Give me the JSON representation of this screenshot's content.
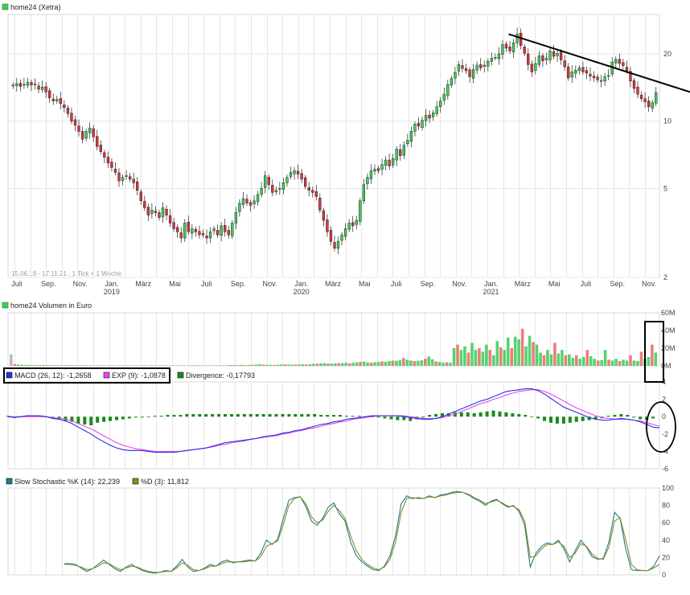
{
  "colors": {
    "up": "#3ecf5a",
    "down": "#d9373b",
    "volume_up": "#55d36e",
    "volume_down": "#ef7c7c",
    "volume_neutral": "#bbbbbb",
    "macd": "#2233dd",
    "signal": "#ee44ee",
    "divergence": "#1a8a1a",
    "stoch_k": "#1f7f86",
    "stoch_d": "#8a8a2a",
    "annotation": "#000000"
  },
  "chart_data": [
    {
      "type": "candlestick",
      "title": "home24 (Xetra)",
      "yscale": "log",
      "ylim": [
        2,
        30
      ],
      "yticks": [
        2,
        5,
        10,
        20
      ],
      "annotation": "15.06.18 - 17.11.21 , 1 Tick = 1 Woche",
      "xticks": [
        "Juli",
        "Sep.",
        "Nov.",
        "Jan.",
        "März",
        "Mai",
        "Juli",
        "Sep.",
        "Nov.",
        "Jan.",
        "März",
        "Mai",
        "Juli",
        "Sep.",
        "Nov.",
        "Jan.",
        "März",
        "Mai",
        "Juli",
        "Sep.",
        "Nov."
      ],
      "years": [
        "2019",
        "2020",
        "2021"
      ],
      "close": [
        14.5,
        14.7,
        14.3,
        14.6,
        14.9,
        14.5,
        14.6,
        13.9,
        14.2,
        13.5,
        12.7,
        12.3,
        12.5,
        12.0,
        11.5,
        10.8,
        10.0,
        9.6,
        9.0,
        8.3,
        9.0,
        9.3,
        8.5,
        7.7,
        7.3,
        6.9,
        6.5,
        6.2,
        5.9,
        5.4,
        5.6,
        5.7,
        5.5,
        5.3,
        4.9,
        4.4,
        4.1,
        3.8,
        4.0,
        3.9,
        3.7,
        4.1,
        3.8,
        3.5,
        3.3,
        3.2,
        3.0,
        3.5,
        3.2,
        3.3,
        3.2,
        3.1,
        3.1,
        3.0,
        3.2,
        3.3,
        3.1,
        3.4,
        3.2,
        3.1,
        3.5,
        3.9,
        4.3,
        4.5,
        4.3,
        4.2,
        4.4,
        4.7,
        5.0,
        5.7,
        5.2,
        4.8,
        4.9,
        5.0,
        5.3,
        5.6,
        5.9,
        6.0,
        5.8,
        5.5,
        5.1,
        4.9,
        4.8,
        4.6,
        4.0,
        3.6,
        3.2,
        2.9,
        2.7,
        2.9,
        3.1,
        3.3,
        3.5,
        3.4,
        3.6,
        4.4,
        5.2,
        5.6,
        6.0,
        6.1,
        6.0,
        6.4,
        6.7,
        6.3,
        6.8,
        7.5,
        7.0,
        7.8,
        8.2,
        9.0,
        9.7,
        9.5,
        10.1,
        10.6,
        10.3,
        10.9,
        11.6,
        12.3,
        13.2,
        14.6,
        15.5,
        16.5,
        17.9,
        17.2,
        16.8,
        15.8,
        17.0,
        17.8,
        17.3,
        17.8,
        18.5,
        19.1,
        19.3,
        20.0,
        22.0,
        21.2,
        20.6,
        22.4,
        24.5,
        21.8,
        20.1,
        17.9,
        16.6,
        18.1,
        19.6,
        18.6,
        19.1,
        20.6,
        19.5,
        20.1,
        18.8,
        17.5,
        15.6,
        16.6,
        16.9,
        17.3,
        16.6,
        16.4,
        15.9,
        15.6,
        15.3,
        15.2,
        15.8,
        16.0,
        18.4,
        18.9,
        18.1,
        17.7,
        16.8,
        15.1,
        14.0,
        13.2,
        12.6,
        12.2,
        11.6,
        12.1,
        13.4
      ],
      "line": {
        "from_date": "Jan. 2021",
        "to": "beyond Nov. 2021",
        "style": "resistance"
      }
    },
    {
      "type": "bar",
      "title": "home24 Volumen in Euro",
      "yticks": [
        "0M",
        "20M",
        "40M",
        "60M"
      ],
      "ylim": [
        0,
        60
      ],
      "values": [
        13.0,
        2.0,
        1.5,
        1.2,
        1.0,
        1.1,
        0.9,
        0.8,
        0.9,
        1.0,
        0.8,
        0.7,
        0.8,
        0.6,
        0.7,
        0.6,
        0.8,
        0.7,
        0.6,
        0.5,
        0.7,
        0.6,
        0.6,
        0.5,
        0.6,
        0.5,
        0.4,
        0.5,
        0.6,
        0.4,
        0.5,
        0.5,
        0.4,
        0.6,
        0.4,
        0.5,
        0.4,
        0.6,
        0.4,
        0.5,
        0.4,
        0.4,
        0.5,
        0.6,
        0.4,
        0.5,
        0.4,
        0.5,
        0.4,
        0.4,
        0.5,
        0.5,
        0.6,
        0.5,
        0.4,
        0.5,
        0.4,
        0.5,
        0.6,
        0.4,
        0.7,
        0.9,
        1.0,
        0.8,
        1.1,
        0.9,
        1.0,
        1.2,
        1.5,
        1.8,
        1.3,
        1.1,
        1.2,
        1.0,
        1.3,
        1.5,
        1.6,
        1.4,
        1.3,
        1.5,
        1.6,
        1.8,
        1.6,
        1.9,
        2.2,
        2.5,
        2.8,
        3.0,
        2.6,
        2.4,
        2.8,
        3.0,
        3.2,
        3.4,
        2.9,
        3.5,
        4.0,
        4.5,
        4.8,
        3.8,
        3.6,
        4.2,
        4.4,
        5.0,
        4.6,
        5.5,
        6.0,
        5.8,
        6.5,
        9.0,
        7.0,
        6.0,
        5.5,
        5.8,
        6.2,
        8.0,
        10.5,
        7.5,
        5.0,
        4.5,
        3.5,
        4.0,
        3.5,
        20.0,
        24.0,
        18.0,
        22.0,
        15.0,
        26.0,
        18.0,
        20.0,
        16.0,
        24.0,
        18.0,
        12.0,
        28.0,
        21.0,
        18.0,
        32.0,
        20.0,
        33.0,
        30.0,
        42.0,
        22.0,
        34.0,
        27.0,
        24.0,
        15.0,
        12.0,
        18.0,
        13.0,
        26.0,
        14.0,
        18.0,
        12.0,
        13.0,
        9.0,
        12.0,
        8.0,
        10.0,
        18.0,
        11.0,
        8.0,
        6.0,
        6.5,
        18.0,
        7.0,
        6.0,
        8.0,
        5.5,
        7.0,
        6.0,
        12.0,
        6.0,
        5.5,
        16.0,
        8.0,
        10.0,
        24.0,
        15.0
      ]
    },
    {
      "type": "line",
      "title": "MACD",
      "yticks": [
        "-6",
        "-4",
        "-2",
        "0",
        "2",
        "4"
      ],
      "ylim": [
        -6,
        4
      ],
      "legend": [
        {
          "label": "MACD (26, 12): -1,2658",
          "color_key": "macd"
        },
        {
          "label": "EXP (9): -1,0878",
          "color_key": "signal"
        },
        {
          "label": "Divergence: -0,17793",
          "color_key": "divergence"
        }
      ],
      "series": [
        {
          "name": "MACD (26, 12)",
          "color_key": "macd",
          "values": [
            0.0,
            -0.1,
            0.0,
            0.1,
            0.1,
            0.1,
            0.0,
            -0.2,
            -0.3,
            -0.5,
            -0.8,
            -1.2,
            -1.6,
            -2.0,
            -2.5,
            -2.9,
            -3.3,
            -3.6,
            -3.8,
            -3.9,
            -3.9,
            -3.9,
            -4.0,
            -4.1,
            -4.1,
            -4.1,
            -4.1,
            -4.0,
            -3.9,
            -3.8,
            -3.7,
            -3.6,
            -3.4,
            -3.2,
            -3.0,
            -2.9,
            -2.8,
            -2.7,
            -2.6,
            -2.5,
            -2.3,
            -2.2,
            -2.1,
            -1.9,
            -1.8,
            -1.6,
            -1.5,
            -1.3,
            -1.1,
            -0.9,
            -0.8,
            -0.6,
            -0.5,
            -0.3,
            -0.2,
            -0.1,
            0.0,
            0.1,
            0.1,
            0.1,
            0.1,
            0.1,
            0.0,
            -0.1,
            -0.2,
            -0.3,
            -0.3,
            -0.2,
            0.0,
            0.3,
            0.6,
            0.9,
            1.2,
            1.5,
            1.8,
            2.0,
            2.3,
            2.6,
            2.9,
            3.0,
            3.1,
            3.2,
            3.2,
            3.0,
            2.6,
            2.1,
            1.6,
            1.1,
            0.8,
            0.5,
            0.2,
            -0.1,
            -0.3,
            -0.4,
            -0.4,
            -0.3,
            -0.2,
            -0.3,
            -0.4,
            -0.6,
            -0.9,
            -1.2,
            -1.3
          ]
        },
        {
          "name": "EXP (9)",
          "color_key": "signal",
          "values": [
            0.0,
            0.0,
            0.0,
            0.0,
            0.0,
            0.0,
            0.0,
            -0.1,
            -0.2,
            -0.3,
            -0.5,
            -0.8,
            -1.1,
            -1.4,
            -1.8,
            -2.2,
            -2.6,
            -3.0,
            -3.3,
            -3.5,
            -3.7,
            -3.8,
            -3.9,
            -4.0,
            -4.0,
            -4.0,
            -4.0,
            -4.0,
            -3.9,
            -3.8,
            -3.7,
            -3.6,
            -3.5,
            -3.3,
            -3.2,
            -3.0,
            -2.9,
            -2.8,
            -2.6,
            -2.5,
            -2.4,
            -2.3,
            -2.2,
            -2.0,
            -1.9,
            -1.7,
            -1.6,
            -1.4,
            -1.3,
            -1.1,
            -0.9,
            -0.8,
            -0.6,
            -0.5,
            -0.3,
            -0.2,
            -0.1,
            0.0,
            0.1,
            0.1,
            0.1,
            0.1,
            0.1,
            0.0,
            -0.1,
            -0.2,
            -0.2,
            -0.2,
            -0.1,
            0.1,
            0.3,
            0.6,
            0.9,
            1.2,
            1.5,
            1.7,
            2.0,
            2.2,
            2.5,
            2.7,
            2.9,
            3.0,
            3.1,
            3.1,
            2.9,
            2.6,
            2.2,
            1.8,
            1.4,
            1.0,
            0.7,
            0.4,
            0.1,
            -0.1,
            -0.2,
            -0.3,
            -0.3,
            -0.3,
            -0.4,
            -0.5,
            -0.7,
            -0.9,
            -1.1
          ]
        },
        {
          "name": "Divergence",
          "color_key": "divergence",
          "values": [
            0.1,
            -0.1,
            0.0,
            0.1,
            0.1,
            0.1,
            0.0,
            -0.2,
            -0.3,
            -0.5,
            -0.6,
            -0.8,
            -0.9,
            -1.0,
            -0.7,
            -0.6,
            -0.5,
            -0.4,
            -0.3,
            -0.2,
            -0.1,
            -0.1,
            0.0,
            0.1,
            0.1,
            0.2,
            0.2,
            0.2,
            0.3,
            0.3,
            0.3,
            0.3,
            0.3,
            0.3,
            0.3,
            0.3,
            0.3,
            0.3,
            0.3,
            0.3,
            0.3,
            0.3,
            0.3,
            0.3,
            0.3,
            0.3,
            0.3,
            0.3,
            0.3,
            0.2,
            0.2,
            0.2,
            0.2,
            0.1,
            0.1,
            0.1,
            0.0,
            0.0,
            -0.1,
            -0.2,
            -0.3,
            -0.4,
            -0.4,
            -0.5,
            -0.3,
            -0.1,
            0.2,
            0.3,
            0.4,
            0.4,
            0.5,
            0.5,
            0.5,
            0.4,
            0.5,
            0.6,
            0.7,
            0.6,
            0.5,
            0.4,
            0.3,
            0.2,
            0.0,
            -0.2,
            -0.5,
            -0.7,
            -0.8,
            -0.8,
            -0.7,
            -0.6,
            -0.5,
            -0.4,
            -0.3,
            -0.2,
            0.1,
            0.2,
            0.3,
            0.2,
            -0.1,
            -0.3,
            -0.4,
            -0.2
          ]
        }
      ]
    },
    {
      "type": "line",
      "title": "Slow Stochastic",
      "ylim": [
        0,
        100
      ],
      "yticks": [
        "0",
        "20",
        "40",
        "60",
        "80",
        "100"
      ],
      "legend": [
        {
          "label": "Slow Stochastic %K (14): 22,239",
          "color_key": "stoch_k"
        },
        {
          "label": "%D (3): 11,812",
          "color_key": "stoch_d"
        }
      ],
      "series": [
        {
          "name": "Slow Stochastic %K (14)",
          "color_key": "stoch_k",
          "values": [
            13,
            13,
            12,
            8,
            4,
            7,
            12,
            17,
            12,
            7,
            4,
            9,
            12,
            8,
            5,
            3,
            2,
            3,
            5,
            4,
            10,
            18,
            9,
            4,
            5,
            8,
            12,
            10,
            15,
            17,
            14,
            15,
            16,
            17,
            16,
            25,
            40,
            35,
            41,
            65,
            86,
            89,
            90,
            79,
            62,
            57,
            65,
            78,
            83,
            70,
            62,
            38,
            22,
            15,
            10,
            6,
            5,
            10,
            22,
            45,
            82,
            91,
            88,
            89,
            88,
            91,
            89,
            92,
            93,
            95,
            96,
            95,
            92,
            88,
            85,
            80,
            85,
            87,
            82,
            78,
            80,
            73,
            57,
            9,
            25,
            33,
            37,
            35,
            40,
            30,
            15,
            28,
            40,
            32,
            21,
            18,
            19,
            38,
            72,
            65,
            30,
            6,
            5,
            5,
            5,
            10,
            22
          ]
        },
        {
          "name": "%D (3)",
          "color_key": "stoch_d",
          "values": [
            12,
            12,
            11,
            9,
            6,
            7,
            10,
            14,
            13,
            9,
            6,
            8,
            10,
            9,
            6,
            4,
            3,
            3,
            4,
            4,
            8,
            14,
            11,
            6,
            5,
            7,
            10,
            10,
            13,
            15,
            15,
            15,
            15,
            16,
            16,
            21,
            33,
            36,
            39,
            58,
            80,
            88,
            90,
            82,
            67,
            60,
            63,
            73,
            80,
            74,
            65,
            45,
            28,
            18,
            12,
            8,
            6,
            9,
            18,
            38,
            72,
            88,
            89,
            88,
            88,
            90,
            89,
            91,
            92,
            94,
            95,
            95,
            93,
            89,
            86,
            82,
            84,
            86,
            83,
            79,
            79,
            75,
            62,
            20,
            22,
            30,
            35,
            35,
            38,
            33,
            20,
            25,
            36,
            33,
            24,
            19,
            18,
            32,
            62,
            66,
            40,
            12,
            6,
            5,
            5,
            8,
            12
          ]
        }
      ]
    }
  ]
}
